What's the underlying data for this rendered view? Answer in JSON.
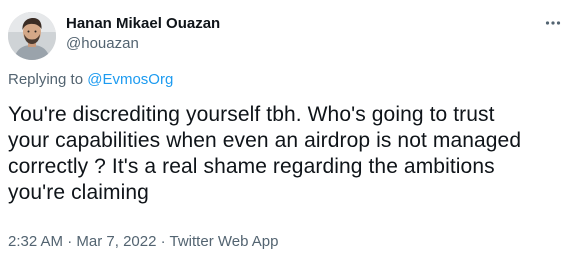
{
  "author": {
    "display_name": "Hanan Mikael Ouazan",
    "handle": "@houazan",
    "avatar_icon": "user-avatar-photo"
  },
  "header": {
    "more_icon": "more-horizontal-icon"
  },
  "reply": {
    "prefix": "Replying to",
    "mention": "@EvmosOrg"
  },
  "tweet": {
    "lines": [
      "You're discrediting yourself tbh. Who's going to trust",
      "your capabilities when even an airdrop is not managed",
      "correctly ? It's a real shame regarding the ambitions",
      "you're claiming"
    ]
  },
  "meta": {
    "time": "2:32 AM",
    "separator": "·",
    "date": "Mar 7, 2022",
    "source": "Twitter Web App"
  },
  "colors": {
    "primary_text": "#0f1419",
    "secondary_text": "#536471",
    "link": "#1d9bf0",
    "background": "#ffffff"
  }
}
